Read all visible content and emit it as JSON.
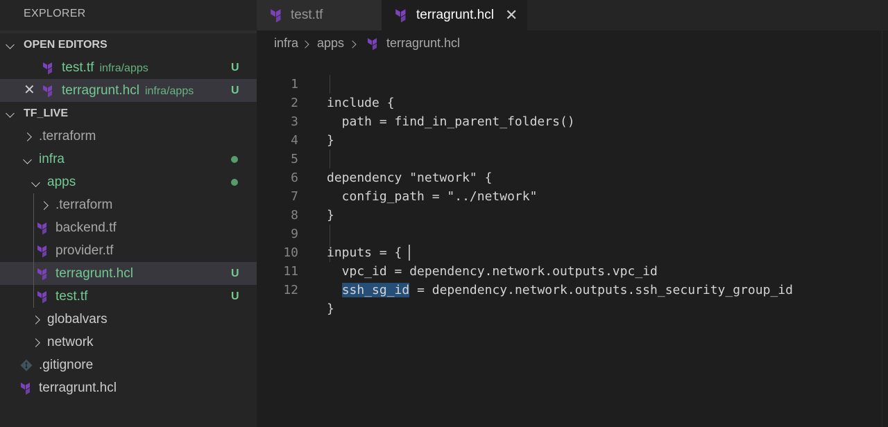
{
  "sidebar": {
    "title": "EXPLORER",
    "open_editors": {
      "header": "OPEN EDITORS",
      "items": [
        {
          "name": "test.tf",
          "path": "infra/apps",
          "badge": "U"
        },
        {
          "name": "terragrunt.hcl",
          "path": "infra/apps",
          "badge": "U"
        }
      ]
    },
    "workspace": {
      "header": "TF_LIVE",
      "tree": {
        "terraform_root": ".terraform",
        "infra": "infra",
        "apps": "apps",
        "apps_terraform": ".terraform",
        "backend": "backend.tf",
        "provider": "provider.tf",
        "terragrunt_apps": "terragrunt.hcl",
        "terragrunt_apps_badge": "U",
        "test": "test.tf",
        "test_badge": "U",
        "globalvars": "globalvars",
        "network": "network",
        "gitignore": ".gitignore",
        "terragrunt_root": "terragrunt.hcl"
      }
    }
  },
  "tabs": [
    {
      "label": "test.tf",
      "active": false
    },
    {
      "label": "terragrunt.hcl",
      "active": true,
      "close": "✕"
    }
  ],
  "breadcrumb": [
    "infra",
    "apps",
    "terragrunt.hcl"
  ],
  "editor": {
    "lines": [
      {
        "n": "1",
        "text": "include {"
      },
      {
        "n": "2",
        "text": "  path = find_in_parent_folders()"
      },
      {
        "n": "3",
        "text": "}"
      },
      {
        "n": "4",
        "text": ""
      },
      {
        "n": "5",
        "text": "dependency \"network\" {"
      },
      {
        "n": "6",
        "text": "  config_path = \"../network\""
      },
      {
        "n": "7",
        "text": "}"
      },
      {
        "n": "8",
        "text": ""
      },
      {
        "n": "9",
        "text": "inputs = {"
      },
      {
        "n": "10",
        "text": "  vpc_id = dependency.network.outputs.vpc_id"
      },
      {
        "n": "11",
        "selected": "ssh_sg_id",
        "rest": " = dependency.network.outputs.ssh_security_group_id"
      },
      {
        "n": "12",
        "text": "}"
      }
    ]
  },
  "colors": {
    "terraform_icon": "#7b42bc",
    "git_untracked": "#73c991",
    "selection": "#264f78"
  }
}
